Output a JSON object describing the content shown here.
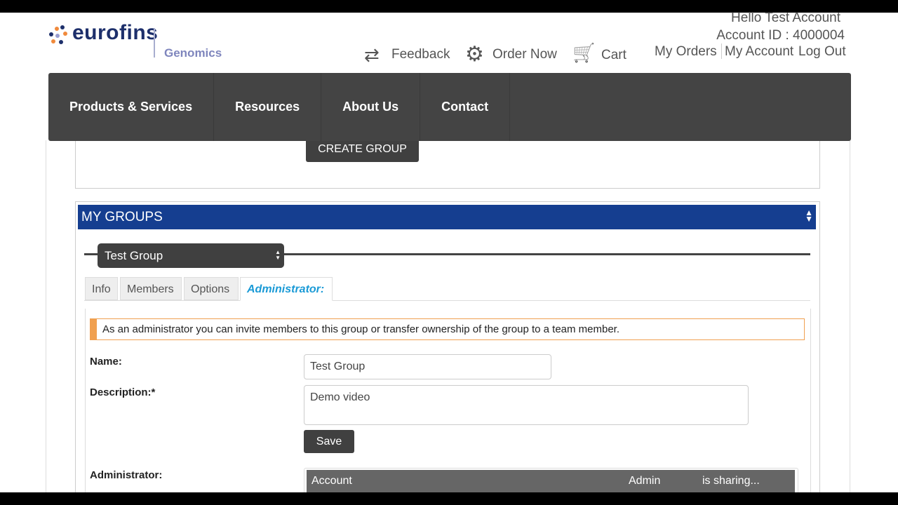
{
  "logo": {
    "brand": "eurofins",
    "division": "Genomics"
  },
  "account": {
    "greeting": "Hello  Test Account",
    "account_id": "Account ID : 4000004"
  },
  "toplinks": {
    "feedback": "Feedback",
    "order_now": "Order Now",
    "cart": "Cart",
    "my_orders": "My Orders",
    "my_account": "My Account",
    "log_out": "Log Out"
  },
  "nav": [
    "Products & Services",
    "Resources",
    "About Us",
    "Contact"
  ],
  "create_group": "CREATE GROUP",
  "my_groups": {
    "title": "MY GROUPS",
    "selected_group": "Test Group",
    "tabs": [
      "Info",
      "Members",
      "Options",
      "Administrator:"
    ],
    "notice": "As an administrator you can invite members to this group or transfer ownership of the group to a team member.",
    "name_label": "Name:",
    "name_value": "Test Group",
    "desc_label": "Description:*",
    "desc_value": "Demo video",
    "save": "Save",
    "admin_label": "Administrator:",
    "table_headers": [
      "Account",
      "Admin",
      "is sharing..."
    ]
  },
  "colors": {
    "header_blue": "#153e90",
    "tab_active": "#1a9ad6",
    "notice_orange": "#f0a050"
  }
}
